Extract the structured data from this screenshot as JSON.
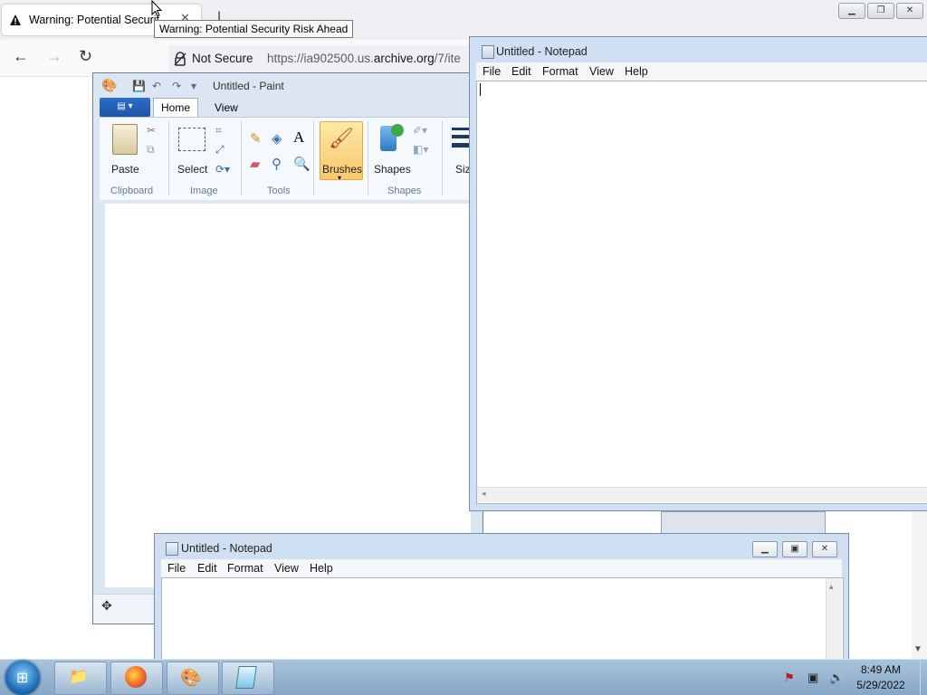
{
  "browser": {
    "tab_title": "Warning: Potential Security Risk Ahead",
    "tab_title_truncated": "Warning: Potential Securit",
    "tooltip": "Warning: Potential Security Risk Ahead",
    "not_secure_label": "Not Secure",
    "url_host_prefix": "https://ia902500.us.",
    "url_host_domain": "archive.org",
    "url_path": "/7/ite",
    "icons": {
      "back": "back-arrow-icon",
      "forward": "forward-arrow-icon",
      "reload": "reload-icon",
      "lock": "lock-slash-icon",
      "warning": "warning-icon"
    }
  },
  "paint": {
    "title": "Untitled - Paint",
    "tabs": [
      "Home",
      "View"
    ],
    "buttons": {
      "paste": "Paste",
      "select": "Select",
      "brushes": "Brushes",
      "shapes": "Shapes",
      "size": "Siz"
    },
    "groups": [
      "Clipboard",
      "Image",
      "Tools",
      "Shapes"
    ],
    "accent": "#f8c76b"
  },
  "notepad_main": {
    "title": "Untitled - Notepad",
    "menu": [
      "File",
      "Edit",
      "Format",
      "View",
      "Help"
    ],
    "content": ""
  },
  "notepad_secondary": {
    "title": "Untitled - Notepad",
    "menu": [
      "File",
      "Edit",
      "Format",
      "View",
      "Help"
    ],
    "content": ""
  },
  "taskbar": {
    "time": "8:49 AM",
    "date": "5/29/2022",
    "apps": [
      "explorer-icon",
      "firefox-icon",
      "paint-icon",
      "notepad-icon"
    ]
  }
}
